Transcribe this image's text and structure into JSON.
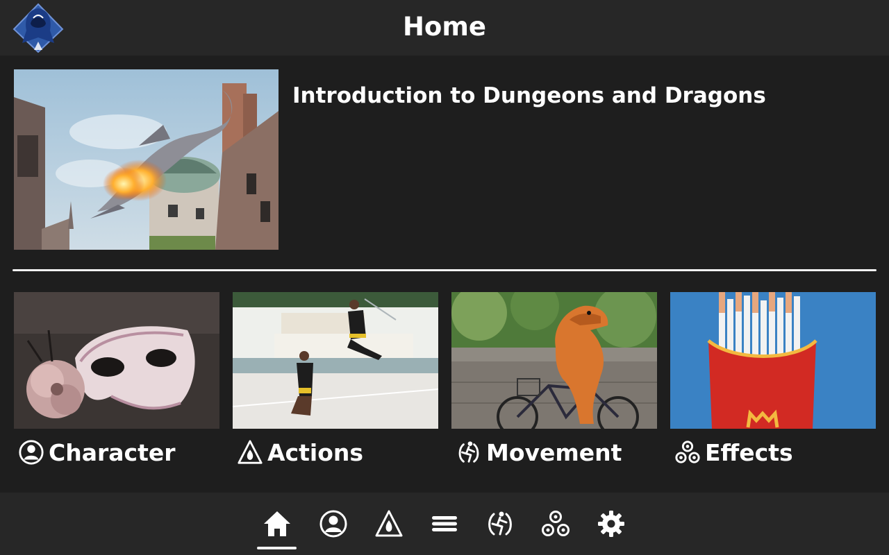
{
  "header": {
    "title": "Home",
    "logo_icon": "hooded-figure-logo"
  },
  "feature": {
    "title": "Introduction to Dungeons and Dragons",
    "image": "dragon-on-castle-breathing-fire"
  },
  "categories": [
    {
      "label": "Character",
      "icon": "person-circle-icon",
      "image": "carnival-mask"
    },
    {
      "label": "Actions",
      "icon": "flame-triangle-icon",
      "image": "martial-arts-jump"
    },
    {
      "label": "Movement",
      "icon": "runner-circle-icon",
      "image": "dinosaur-on-bicycle"
    },
    {
      "label": "Effects",
      "icon": "three-circles-icon",
      "image": "cigarettes-in-fries-box"
    }
  ],
  "bottom_nav": {
    "items": [
      {
        "name": "home",
        "icon": "home-icon",
        "selected": true
      },
      {
        "name": "character",
        "icon": "person-circle-icon",
        "selected": false
      },
      {
        "name": "actions",
        "icon": "flame-triangle-icon",
        "selected": false
      },
      {
        "name": "menu",
        "icon": "hamburger-menu-icon",
        "selected": false
      },
      {
        "name": "movement",
        "icon": "runner-circle-icon",
        "selected": false
      },
      {
        "name": "effects",
        "icon": "three-circles-icon",
        "selected": false
      },
      {
        "name": "settings",
        "icon": "gear-icon",
        "selected": false
      }
    ]
  },
  "colors": {
    "background": "#1e1e1e",
    "bars": "#272727",
    "text": "#ffffff",
    "logo_blue": "#2f5aa8"
  }
}
